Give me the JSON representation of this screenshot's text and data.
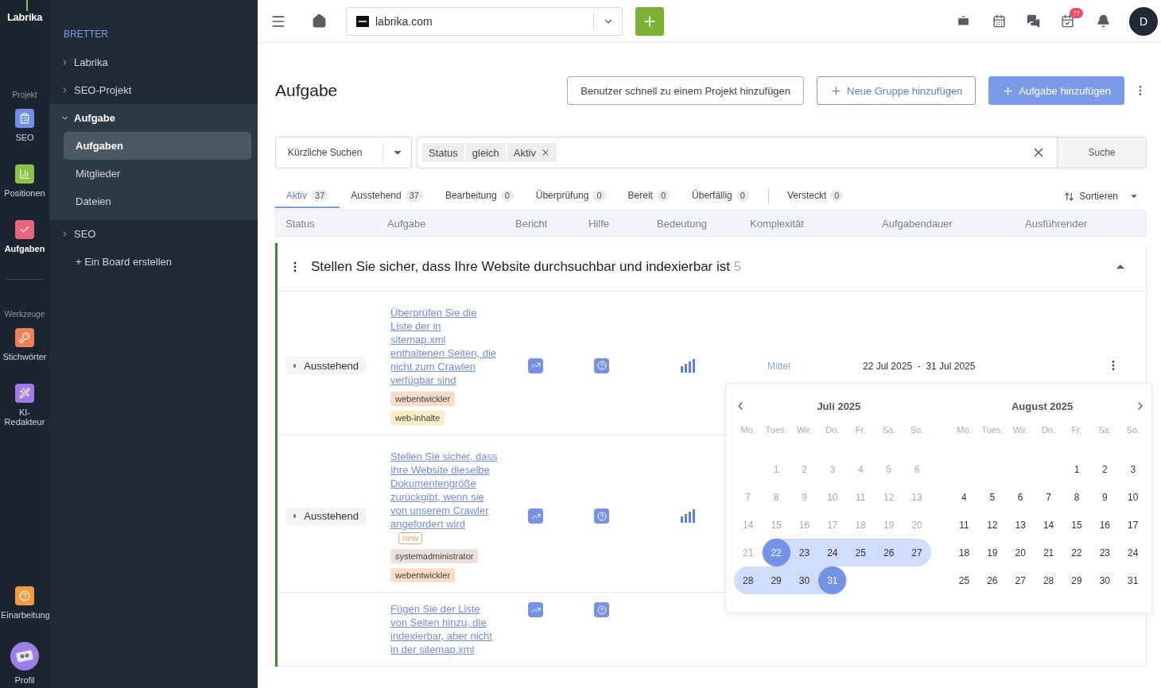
{
  "rail": {
    "logo": "Labrika",
    "groups": [
      {
        "label": "Projekt",
        "items": [
          {
            "label": "SEO",
            "selected": false
          },
          {
            "label": "Positionen",
            "selected": false
          },
          {
            "label": "Aufgaben",
            "selected": true
          }
        ]
      },
      {
        "label": "Werkzeuge",
        "items": [
          {
            "label": "Stichwörter",
            "selected": false
          },
          {
            "label": "KI-Redakteur",
            "selected": false
          }
        ]
      }
    ],
    "bottom": [
      {
        "label": "Einarbeitung",
        "selected": false
      },
      {
        "label": "Profil",
        "selected": false
      }
    ]
  },
  "sidebar": {
    "heading": "BRETTER",
    "boards": [
      {
        "label": "Labrika",
        "expanded": false
      },
      {
        "label": "SEO-Projekt",
        "expanded": false
      },
      {
        "label": "Aufgabe",
        "expanded": true,
        "children": [
          {
            "label": "Aufgaben",
            "selected": true
          },
          {
            "label": "Mitglieder",
            "selected": false
          },
          {
            "label": "Dateien",
            "selected": false
          }
        ]
      },
      {
        "label": "SEO",
        "expanded": false
      }
    ],
    "create": "+ Ein Board erstellen"
  },
  "topbar": {
    "site": "labrika.com",
    "notifications": "77",
    "avatar": "D"
  },
  "page": {
    "title": "Aufgabe",
    "actions": [
      {
        "label": "Benutzer schnell zu einem Projekt hinzufügen",
        "kind": "outline"
      },
      {
        "label": "Neue Gruppe hinzufügen",
        "kind": "add-outline"
      },
      {
        "label": "Aufgabe hinzufügen",
        "kind": "add-primary"
      }
    ]
  },
  "filter": {
    "recent": "Kürzliche Suchen",
    "chips": [
      "Status",
      "gleich",
      "Aktiv"
    ],
    "search_button": "Suche"
  },
  "tabs": [
    {
      "label": "Aktiv",
      "count": "37",
      "selected": true,
      "separated": false
    },
    {
      "label": "Ausstehend",
      "count": "37",
      "selected": false,
      "separated": false
    },
    {
      "label": "Bearbeitung",
      "count": "0",
      "selected": false,
      "separated": false
    },
    {
      "label": "Überprüfung",
      "count": "0",
      "selected": false,
      "separated": false
    },
    {
      "label": "Bereit",
      "count": "0",
      "selected": false,
      "separated": false
    },
    {
      "label": "Überfällig",
      "count": "0",
      "selected": false,
      "separated": false
    },
    {
      "label": "Versteckt",
      "count": "0",
      "selected": false,
      "separated": true
    }
  ],
  "sort": "Sortieren",
  "table": {
    "columns": [
      "Status",
      "Aufgabe",
      "Bericht",
      "Hilfe",
      "Bedeutung",
      "Komplexität",
      "Aufgabendauer",
      "Ausführender"
    ],
    "group": {
      "title": "Stellen Sie sicher, dass Ihre Website durchsuchbar und indexierbar ist",
      "count": "5",
      "expanded": true
    },
    "rows": [
      {
        "status": "Ausstehend",
        "task": "Überprüfen Sie die Liste der in sitemap.xml enthaltenen Seiten, die nicht zum Crawlen verfügbar sind",
        "tags": [
          {
            "label": "webentwickler",
            "color": "#f8dcc8"
          },
          {
            "label": "web-inhalte",
            "color": "#fdedc4"
          }
        ],
        "complexity": "Mittel",
        "dates": "22 Jul 2025  -  31 Jul 2025"
      },
      {
        "status": "Ausstehend",
        "task": "Stellen Sie sicher, dass Ihre Website dieselbe Dokumentengröße zurückgibt, wenn sie von unserem Crawler angefordert wird",
        "badge": "new",
        "tags": [
          {
            "label": "systemadministrator",
            "color": "#eee0da"
          },
          {
            "label": "webentwickler",
            "color": "#f8dcc8"
          }
        ]
      },
      {
        "task": "Fügen Sie der Liste von Seiten hinzu, die indexierbar, aber nicht in der sitemap.xml"
      }
    ]
  },
  "calendar": {
    "months": [
      {
        "title": "Juli 2025",
        "weekdays": [
          "Mo.",
          "Tues.",
          "Wir.",
          "Do.",
          "Fr.",
          "Sa.",
          "So."
        ],
        "weeks": [
          [
            {
              "kind": "blank"
            },
            {
              "kind": "day",
              "day": "1",
              "disabled": true,
              "in_range": false,
              "endpoint": false
            },
            {
              "kind": "day",
              "day": "2",
              "disabled": true,
              "in_range": false,
              "endpoint": false
            },
            {
              "kind": "day",
              "day": "3",
              "disabled": true,
              "in_range": false,
              "endpoint": false
            },
            {
              "kind": "day",
              "day": "4",
              "disabled": true,
              "in_range": false,
              "endpoint": false
            },
            {
              "kind": "day",
              "day": "5",
              "disabled": true,
              "in_range": false,
              "endpoint": false
            },
            {
              "kind": "day",
              "day": "6",
              "disabled": true,
              "in_range": false,
              "endpoint": false
            }
          ],
          [
            {
              "kind": "day",
              "day": "7",
              "disabled": true,
              "in_range": false,
              "endpoint": false
            },
            {
              "kind": "day",
              "day": "8",
              "disabled": true,
              "in_range": false,
              "endpoint": false
            },
            {
              "kind": "day",
              "day": "9",
              "disabled": true,
              "in_range": false,
              "endpoint": false
            },
            {
              "kind": "day",
              "day": "10",
              "disabled": true,
              "in_range": false,
              "endpoint": false
            },
            {
              "kind": "day",
              "day": "11",
              "disabled": true,
              "in_range": false,
              "endpoint": false
            },
            {
              "kind": "day",
              "day": "12",
              "disabled": true,
              "in_range": false,
              "endpoint": false
            },
            {
              "kind": "day",
              "day": "13",
              "disabled": true,
              "in_range": false,
              "endpoint": false
            }
          ],
          [
            {
              "kind": "day",
              "day": "14",
              "disabled": true,
              "in_range": false,
              "endpoint": false
            },
            {
              "kind": "day",
              "day": "15",
              "disabled": true,
              "in_range": false,
              "endpoint": false
            },
            {
              "kind": "day",
              "day": "16",
              "disabled": true,
              "in_range": false,
              "endpoint": false
            },
            {
              "kind": "day",
              "day": "17",
              "disabled": true,
              "in_range": false,
              "endpoint": false
            },
            {
              "kind": "day",
              "day": "18",
              "disabled": true,
              "in_range": false,
              "endpoint": false
            },
            {
              "kind": "day",
              "day": "19",
              "disabled": true,
              "in_range": false,
              "endpoint": false
            },
            {
              "kind": "day",
              "day": "20",
              "disabled": true,
              "in_range": false,
              "endpoint": false
            }
          ],
          [
            {
              "kind": "day",
              "day": "21",
              "disabled": true,
              "in_range": false,
              "endpoint": false
            },
            {
              "kind": "day",
              "day": "22",
              "disabled": false,
              "in_range": true,
              "endpoint": true
            },
            {
              "kind": "day",
              "day": "23",
              "disabled": false,
              "in_range": true,
              "endpoint": false
            },
            {
              "kind": "day",
              "day": "24",
              "disabled": false,
              "in_range": true,
              "endpoint": false
            },
            {
              "kind": "day",
              "day": "25",
              "disabled": false,
              "in_range": true,
              "endpoint": false
            },
            {
              "kind": "day",
              "day": "26",
              "disabled": false,
              "in_range": true,
              "endpoint": false
            },
            {
              "kind": "day",
              "day": "27",
              "disabled": false,
              "in_range": true,
              "endpoint": false
            }
          ],
          [
            {
              "kind": "day",
              "day": "28",
              "disabled": false,
              "in_range": true,
              "endpoint": false
            },
            {
              "kind": "day",
              "day": "29",
              "disabled": false,
              "in_range": true,
              "endpoint": false
            },
            {
              "kind": "day",
              "day": "30",
              "disabled": false,
              "in_range": true,
              "endpoint": false
            },
            {
              "kind": "day",
              "day": "31",
              "disabled": false,
              "in_range": true,
              "endpoint": true
            }
          ]
        ]
      },
      {
        "title": "August 2025",
        "weekdays": [
          "Mo.",
          "Tues.",
          "Wir.",
          "Do.",
          "Fr.",
          "Sa.",
          "So."
        ],
        "weeks": [
          [
            {
              "kind": "blank"
            },
            {
              "kind": "blank"
            },
            {
              "kind": "blank"
            },
            {
              "kind": "blank"
            },
            {
              "kind": "day",
              "day": "1",
              "disabled": false,
              "in_range": false,
              "endpoint": false
            },
            {
              "kind": "day",
              "day": "2",
              "disabled": false,
              "in_range": false,
              "endpoint": false
            },
            {
              "kind": "day",
              "day": "3",
              "disabled": false,
              "in_range": false,
              "endpoint": false
            }
          ],
          [
            {
              "kind": "day",
              "day": "4",
              "disabled": false,
              "in_range": false,
              "endpoint": false
            },
            {
              "kind": "day",
              "day": "5",
              "disabled": false,
              "in_range": false,
              "endpoint": false
            },
            {
              "kind": "day",
              "day": "6",
              "disabled": false,
              "in_range": false,
              "endpoint": false
            },
            {
              "kind": "day",
              "day": "7",
              "disabled": false,
              "in_range": false,
              "endpoint": false
            },
            {
              "kind": "day",
              "day": "8",
              "disabled": false,
              "in_range": false,
              "endpoint": false
            },
            {
              "kind": "day",
              "day": "9",
              "disabled": false,
              "in_range": false,
              "endpoint": false
            },
            {
              "kind": "day",
              "day": "10",
              "disabled": false,
              "in_range": false,
              "endpoint": false
            }
          ],
          [
            {
              "kind": "day",
              "day": "11",
              "disabled": false,
              "in_range": false,
              "endpoint": false
            },
            {
              "kind": "day",
              "day": "12",
              "disabled": false,
              "in_range": false,
              "endpoint": false
            },
            {
              "kind": "day",
              "day": "13",
              "disabled": false,
              "in_range": false,
              "endpoint": false
            },
            {
              "kind": "day",
              "day": "14",
              "disabled": false,
              "in_range": false,
              "endpoint": false
            },
            {
              "kind": "day",
              "day": "15",
              "disabled": false,
              "in_range": false,
              "endpoint": false
            },
            {
              "kind": "day",
              "day": "16",
              "disabled": false,
              "in_range": false,
              "endpoint": false
            },
            {
              "kind": "day",
              "day": "17",
              "disabled": false,
              "in_range": false,
              "endpoint": false
            }
          ],
          [
            {
              "kind": "day",
              "day": "18",
              "disabled": false,
              "in_range": false,
              "endpoint": false
            },
            {
              "kind": "day",
              "day": "19",
              "disabled": false,
              "in_range": false,
              "endpoint": false
            },
            {
              "kind": "day",
              "day": "20",
              "disabled": false,
              "in_range": false,
              "endpoint": false
            },
            {
              "kind": "day",
              "day": "21",
              "disabled": false,
              "in_range": false,
              "endpoint": false
            },
            {
              "kind": "day",
              "day": "22",
              "disabled": false,
              "in_range": false,
              "endpoint": false
            },
            {
              "kind": "day",
              "day": "23",
              "disabled": false,
              "in_range": false,
              "endpoint": false
            },
            {
              "kind": "day",
              "day": "24",
              "disabled": false,
              "in_range": false,
              "endpoint": false
            }
          ],
          [
            {
              "kind": "day",
              "day": "25",
              "disabled": false,
              "in_range": false,
              "endpoint": false
            },
            {
              "kind": "day",
              "day": "26",
              "disabled": false,
              "in_range": false,
              "endpoint": false
            },
            {
              "kind": "day",
              "day": "27",
              "disabled": false,
              "in_range": false,
              "endpoint": false
            },
            {
              "kind": "day",
              "day": "28",
              "disabled": false,
              "in_range": false,
              "endpoint": false
            },
            {
              "kind": "day",
              "day": "29",
              "disabled": false,
              "in_range": false,
              "endpoint": false
            },
            {
              "kind": "day",
              "day": "30",
              "disabled": false,
              "in_range": false,
              "endpoint": false
            },
            {
              "kind": "day",
              "day": "31",
              "disabled": false,
              "in_range": false,
              "endpoint": false
            }
          ]
        ]
      }
    ]
  }
}
